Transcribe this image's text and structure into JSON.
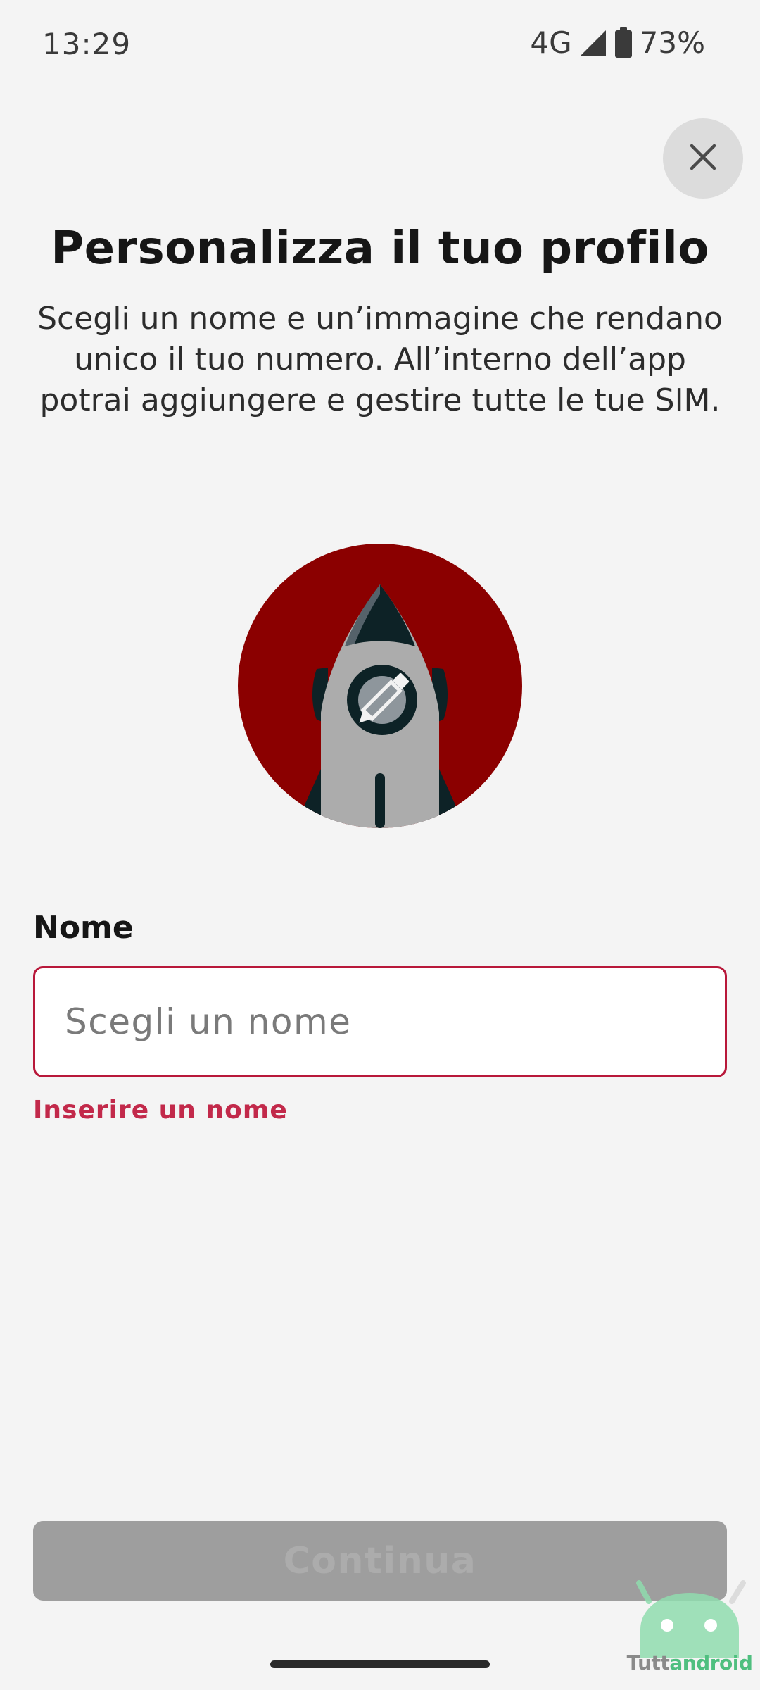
{
  "status_bar": {
    "time": "13:29",
    "network": "4G",
    "battery": "73%"
  },
  "header": {
    "close_icon": "close-icon"
  },
  "main": {
    "title": "Personalizza il tuo profilo",
    "subtitle": "Scegli un nome e un’immagine che rendano unico il tuo numero. All’interno dell’app potrai aggiungere e gestire tutte le tue SIM.",
    "avatar_icon": "rocket-avatar",
    "edit_icon": "pencil-icon",
    "name_label": "Nome",
    "name_value": "",
    "name_placeholder": "Scegli un nome",
    "error_message": "Inserire un nome",
    "continue_label": "Continua"
  },
  "watermark": {
    "brand_plain": "Tutt",
    "brand_accent": "android"
  },
  "colors": {
    "background": "#f4f4f4",
    "accent_red": "#8b0000",
    "error": "#c2294a",
    "disabled_button": "#9e9e9e"
  }
}
